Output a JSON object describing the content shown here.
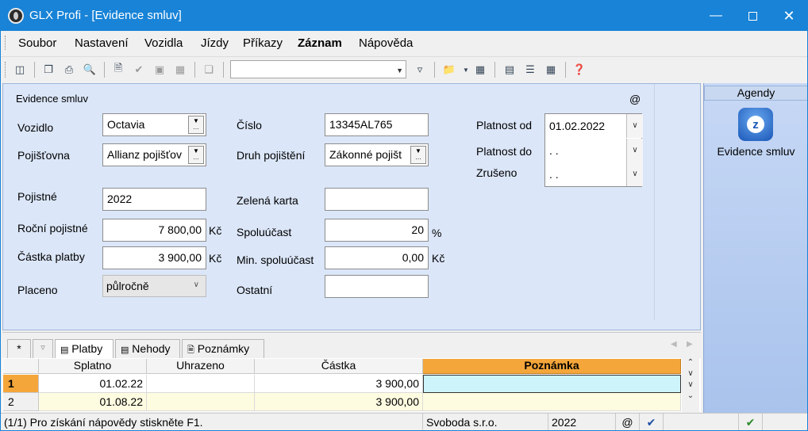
{
  "window": {
    "title": "GLX Profi - [Evidence smluv]"
  },
  "menu": [
    "Soubor",
    "Nastavení",
    "Vozidla",
    "Jízdy",
    "Příkazy",
    "Záznam",
    "Nápověda"
  ],
  "toolbar": {
    "combo_value": ""
  },
  "form": {
    "section_title": "Evidence smluv",
    "at_symbol": "@",
    "vozidlo": {
      "label": "Vozidlo",
      "value": "Octavia"
    },
    "pojistovna": {
      "label": "Pojišťovna",
      "value": "Allianz pojišťov"
    },
    "pojistne_obdobi": {
      "label": "Pojistné",
      "value": "2022"
    },
    "rocni_pojistne": {
      "label": "Roční pojistné",
      "value": "7 800,00",
      "unit": "Kč"
    },
    "castka_platby": {
      "label": "Částka platby",
      "value": "3 900,00",
      "unit": "Kč"
    },
    "placeno": {
      "label": "Placeno",
      "value": "půlročně"
    },
    "cislo": {
      "label": "Číslo",
      "value": "13345AL765"
    },
    "druh_pojisteni": {
      "label": "Druh pojištění",
      "value": "Zákonné pojišt"
    },
    "zelena_karta": {
      "label": "Zelená karta",
      "value": ""
    },
    "spoluucast": {
      "label": "Spoluúčast",
      "value": "20",
      "unit": "%"
    },
    "min_spoluucast": {
      "label": "Min. spoluúčast",
      "value": "0,00",
      "unit": "Kč"
    },
    "ostatni": {
      "label": "Ostatní",
      "value": ""
    },
    "platnost_od": {
      "label": "Platnost od",
      "value": "01.02.2022"
    },
    "platnost_do": {
      "label": "Platnost do",
      "value": " .  ."
    },
    "zruseno": {
      "label": "Zrušeno",
      "value": " .  ."
    }
  },
  "agendy": {
    "title": "Agendy",
    "item": "Evidence smluv"
  },
  "tabs": {
    "star": "*",
    "platby": "Platby",
    "nehody": "Nehody",
    "poznamky": "Poznámky"
  },
  "grid": {
    "columns": [
      "Splatno",
      "Uhrazeno",
      "Částka",
      "Poznámka"
    ],
    "rows": [
      {
        "num": "1",
        "splatno": "01.02.22",
        "uhrazeno": "",
        "castka": "3 900,00",
        "poznamka": ""
      },
      {
        "num": "2",
        "splatno": "01.08.22",
        "uhrazeno": "",
        "castka": "3 900,00",
        "poznamka": ""
      }
    ]
  },
  "status": {
    "help": "(1/1) Pro získání nápovědy stiskněte F1.",
    "company": "Svoboda s.r.o.",
    "year": "2022",
    "at": "@"
  }
}
